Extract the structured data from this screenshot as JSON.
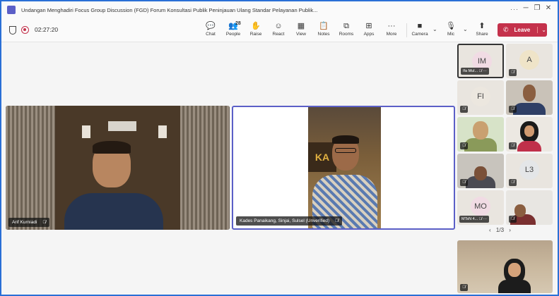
{
  "window": {
    "title": "Undangan Menghadiri Focus Group Discussion (FGD) Forum Konsultasi Publik Peninjauan Ulang Standar Pelayanan Publik...",
    "more": "···",
    "minimize": "─",
    "restore": "❐",
    "close": "✕"
  },
  "toolbar": {
    "timer": "02:27:20",
    "chat": "Chat",
    "people": "People",
    "people_count": "28",
    "raise": "Raise",
    "react": "React",
    "view": "View",
    "notes": "Notes",
    "rooms": "Rooms",
    "apps": "Apps",
    "more": "More",
    "camera": "Camera",
    "mic": "Mic",
    "share": "Share",
    "leave": "Leave"
  },
  "icons": {
    "chat": "💬",
    "people": "👥",
    "raise": "✋",
    "react": "☺",
    "view": "▦",
    "notes": "📋",
    "rooms": "⧉",
    "apps": "⊞",
    "more": "···",
    "camera": "■",
    "mic": "🎙",
    "share": "⬆",
    "leave": "✆",
    "chevron": "⌄",
    "mic_off": "🎙̸"
  },
  "main": {
    "participants": [
      {
        "name": "Arif Kurniadi"
      },
      {
        "name": "Kades Panaikang, Sinjai, Sulsel (Unverified)"
      }
    ],
    "kades_banner": "KA"
  },
  "gallery": {
    "tiles": [
      {
        "initials": "IM",
        "name": "Ifa Mul...",
        "active": true
      },
      {
        "initials": "A"
      },
      {
        "initials": "FI"
      },
      {
        "video": true
      },
      {
        "video": true
      },
      {
        "video": true
      },
      {
        "video": true
      },
      {
        "initials": "L3"
      },
      {
        "initials": "MO",
        "name": "MTsN 4..."
      },
      {
        "video": true
      }
    ],
    "pager": "1/3",
    "prev": "‹",
    "next": "›"
  },
  "colors": {
    "accent": "#5b5fc7",
    "leave": "#c4314b",
    "border": "#2a6fd6"
  }
}
